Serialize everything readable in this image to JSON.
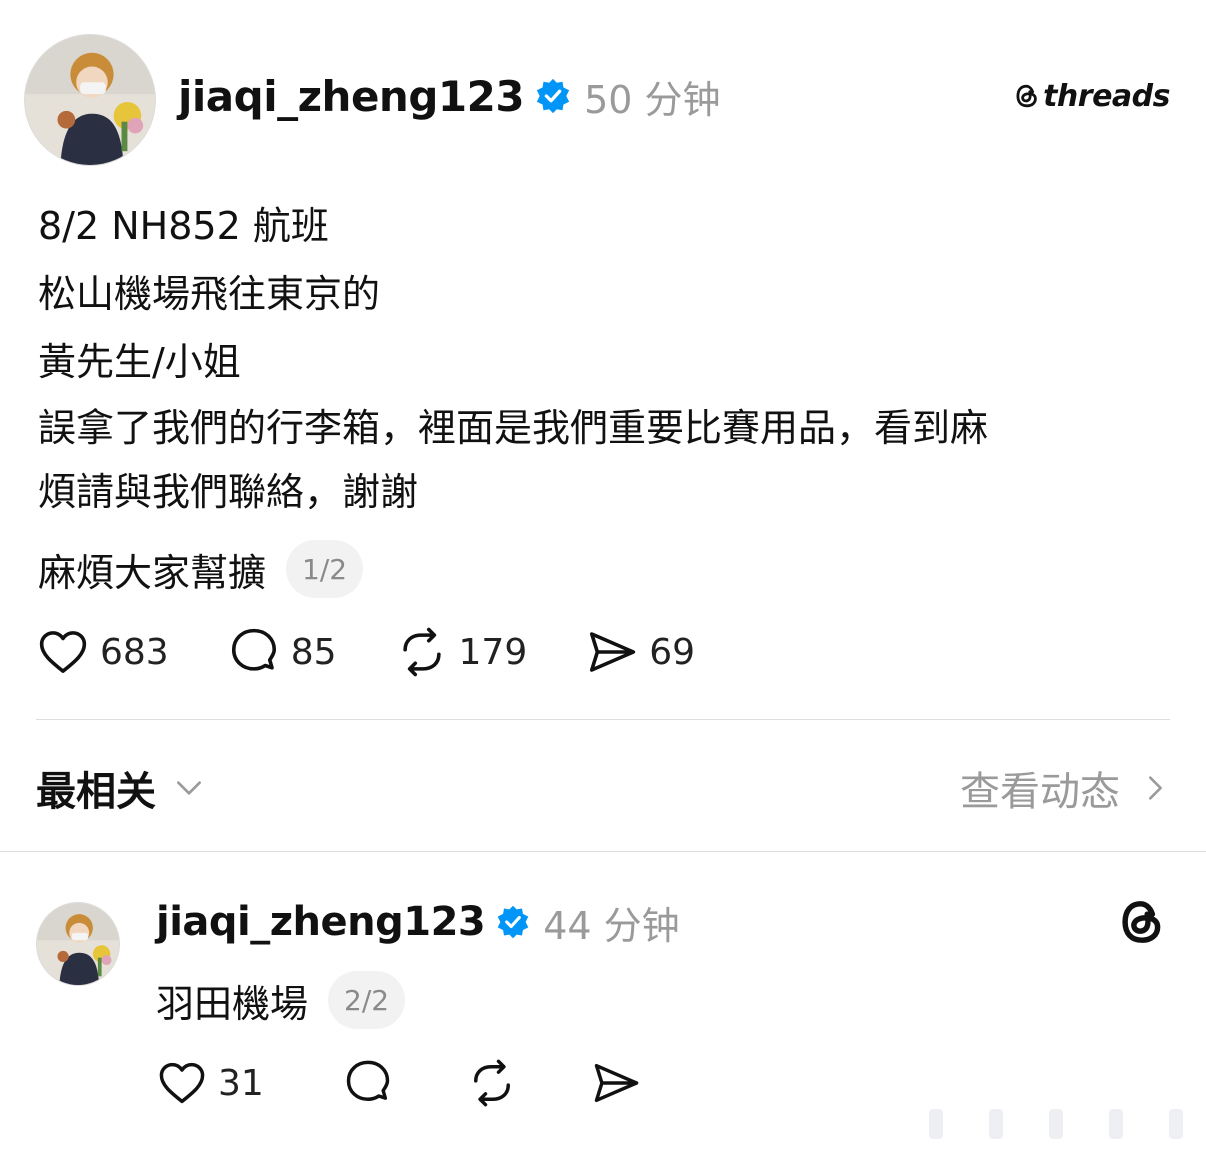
{
  "brand": {
    "name": "threads",
    "icon": "threads-logo-icon"
  },
  "post": {
    "username": "jiaqi_zheng123",
    "verified_icon": "verified-badge-icon",
    "timestamp": "50 分钟",
    "lines": [
      "8/2 NH852 航班",
      "松山機場飛往東京的",
      "黃先生/小姐",
      "誤拿了我們的行李箱，裡面是我們重要比賽用品，看到麻",
      "煩請與我們聯絡，謝謝"
    ],
    "last_line": "麻煩大家幫擴",
    "pager": "1/2",
    "actions": {
      "likes": "683",
      "comments": "85",
      "reposts": "179",
      "shares": "69"
    }
  },
  "sort": {
    "label": "最相关",
    "activity_label": "查看动态"
  },
  "reply": {
    "username": "jiaqi_zheng123",
    "timestamp": "44 分钟",
    "text": "羽田機場",
    "pager": "2/2",
    "actions": {
      "likes": "31"
    }
  },
  "colors": {
    "verified": "#0095f6",
    "muted_text": "#9a9a9a",
    "divider": "#dedede"
  }
}
